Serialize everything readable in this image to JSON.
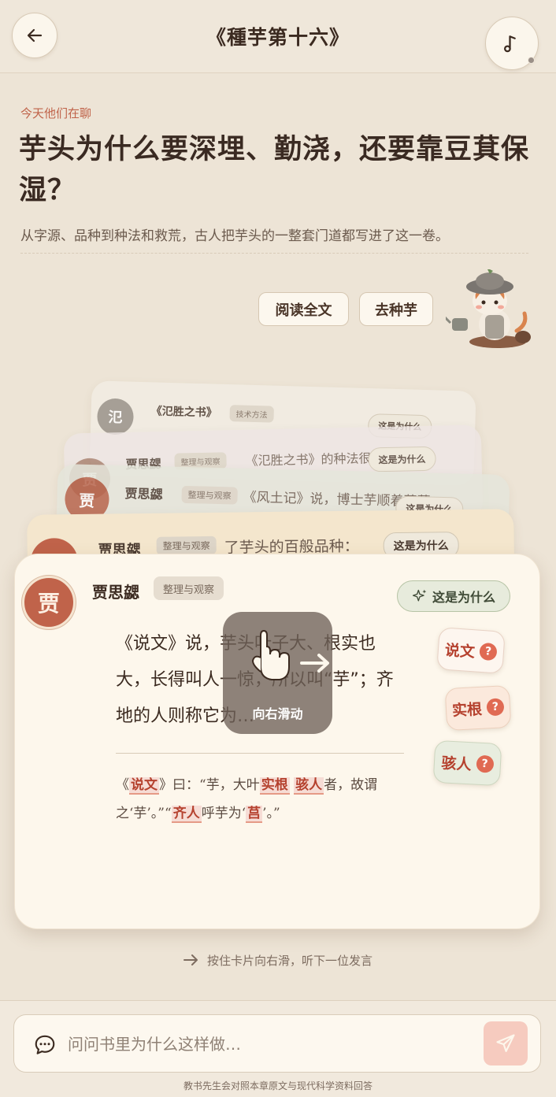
{
  "header": {
    "title": "《種芋第十六》",
    "back_icon": "arrow-left-icon",
    "music_icon": "music-note-icon"
  },
  "intro": {
    "kicker": "今天他们在聊",
    "headline": "芋头为什么要深埋、勤浇，还要靠豆萁保湿？",
    "subline": "从字源、品种到种法和救荒，古人把芋头的一整套门道都写进了这一卷。"
  },
  "actions": {
    "read_full": "阅读全文",
    "go_plant": "去种芋"
  },
  "stack_cards": [
    {
      "avatar": "氾",
      "name": "《氾胜之书》",
      "tag": "技术方法",
      "why": "这是为什么",
      "text": ""
    },
    {
      "avatar": "贾",
      "name": "贾思勰",
      "tag": "整理与观察",
      "why": "这是为什么",
      "text": "《氾胜之书》的种法很讲究：方"
    },
    {
      "avatar": "贾",
      "name": "贾思勰",
      "tag": "整理与观察",
      "why": "这是为什么",
      "text": "《风土记》说，博士芋顺着藤蔓"
    },
    {
      "avatar": "贾",
      "name": "贾思勰",
      "tag": "整理与观察",
      "why": "这是为什么",
      "text": "了芋头的百般品种："
    }
  ],
  "main_card": {
    "avatar": "贾",
    "speaker": "贾思勰",
    "tag": "整理与观察",
    "why": "这是为什么",
    "quote": "《说文》说，芋头叶子大、根实也大，长得叫人一惊，所以叫“芋”；齐地的人则称它为…",
    "classical": {
      "p1": "《",
      "h1": "说文",
      "p2": "》曰：“芋，大叶",
      "h2": "实根",
      "h3": "骇人",
      "p3": "者，故谓之‘芋’。”“",
      "h4": "齐人",
      "p4": "呼芋为‘",
      "h5": "莒",
      "p5": "’。”"
    },
    "terms": [
      {
        "label": "说文",
        "mark": "?"
      },
      {
        "label": "实根",
        "mark": "?"
      },
      {
        "label": "骇人",
        "mark": "?"
      }
    ],
    "swipe_label": "向右滑动"
  },
  "hint": "按住卡片向右滑，听下一位发言",
  "composer": {
    "placeholder": "问问书里为什么这样做…",
    "footnote": "教书先生会对照本章原文与现代科学资料回答"
  },
  "colors": {
    "accent": "#c0634a",
    "background": "#ede4d6",
    "card": "#fdf7ec"
  }
}
